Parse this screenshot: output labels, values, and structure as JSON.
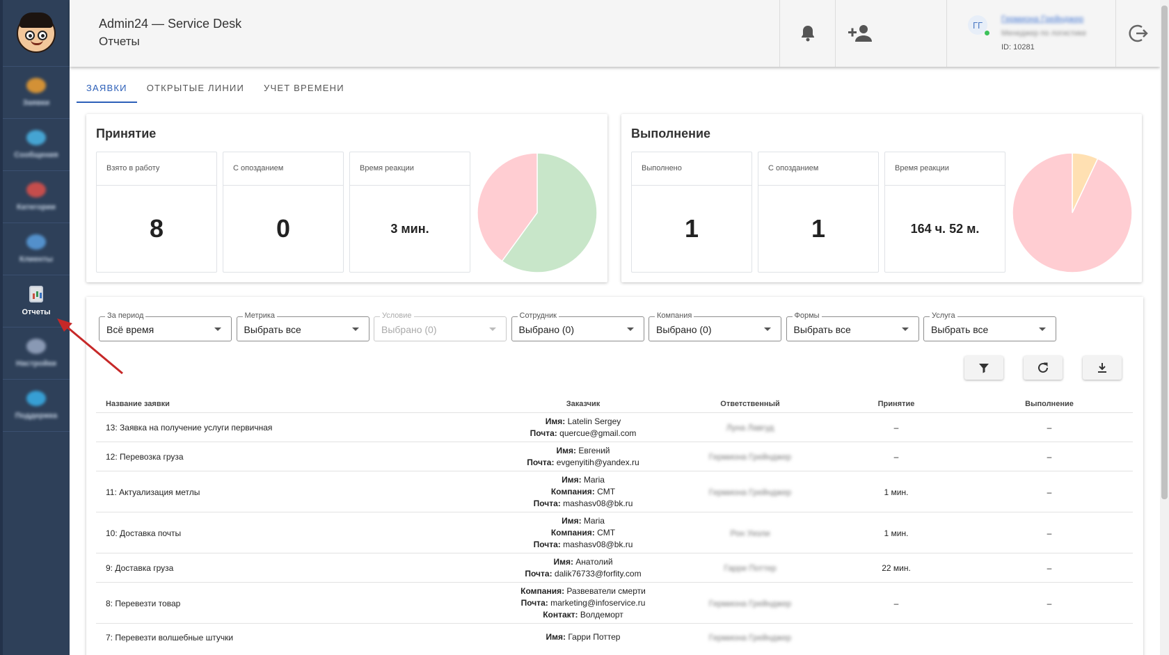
{
  "header": {
    "app_title": "Admin24 — Service Desk",
    "page_subtitle": "Отчеты",
    "user": {
      "initials": "ГГ",
      "name": "Гермиона Грейнджер",
      "role": "Менеджер по логистике",
      "id_text": "ID: 10281"
    }
  },
  "sidebar": {
    "items": [
      {
        "label": "Заявки",
        "icon": "ticket-icon",
        "color": "#f0a030"
      },
      {
        "label": "Сообщения",
        "icon": "chat-icon",
        "color": "#4ab6e8"
      },
      {
        "label": "Категории",
        "icon": "category-icon",
        "color": "#e0504a"
      },
      {
        "label": "Клиенты",
        "icon": "clients-icon",
        "color": "#5a9fe0"
      },
      {
        "label": "Отчеты",
        "icon": "reports-icon",
        "active": true
      },
      {
        "label": "Настройки",
        "icon": "settings-icon",
        "color": "#9aa9c4"
      },
      {
        "label": "Поддержка",
        "icon": "support-icon",
        "color": "#39b0ea"
      }
    ]
  },
  "tabs": [
    {
      "label": "ЗАЯВКИ",
      "active": true
    },
    {
      "label": "ОТКРЫТЫЕ ЛИНИИ"
    },
    {
      "label": "УЧЕТ ВРЕМЕНИ"
    }
  ],
  "acceptance": {
    "title": "Принятие",
    "stats": [
      {
        "label": "Взято в работу",
        "value": "8"
      },
      {
        "label": "С опозданием",
        "value": "0"
      },
      {
        "label": "Время реакции",
        "value": "3 мин."
      }
    ],
    "pie": [
      {
        "share": 0.6,
        "color": "#c8e6c9"
      },
      {
        "share": 0.4,
        "color": "#ffcdd2"
      }
    ]
  },
  "execution": {
    "title": "Выполнение",
    "stats": [
      {
        "label": "Выполнено",
        "value": "1"
      },
      {
        "label": "С опозданием",
        "value": "1"
      },
      {
        "label": "Время реакции",
        "value": "164 ч. 52 м."
      }
    ],
    "pie": [
      {
        "share": 0.07,
        "color": "#ffe0b2"
      },
      {
        "share": 0.93,
        "color": "#ffcdd2"
      }
    ]
  },
  "filters": [
    {
      "label": "За период",
      "value": "Всё время"
    },
    {
      "label": "Метрика",
      "value": "Выбрать все"
    },
    {
      "label": "Условие",
      "value": "Выбрано (0)",
      "disabled": true
    },
    {
      "label": "Сотрудник",
      "value": "Выбрано (0)"
    },
    {
      "label": "Компания",
      "value": "Выбрано (0)"
    },
    {
      "label": "Формы",
      "value": "Выбрать все"
    },
    {
      "label": "Услуга",
      "value": "Выбрать все"
    }
  ],
  "table": {
    "headers": {
      "name": "Название заявки",
      "customer": "Заказчик",
      "responsible": "Ответственный",
      "acceptance": "Принятие",
      "execution": "Выполнение"
    },
    "rows": [
      {
        "name": "13: Заявка на получение услуги первичная",
        "customer": [
          [
            "Имя:",
            "Latelin Sergey"
          ],
          [
            "Почта:",
            "quercue@gmail.com"
          ]
        ],
        "responsible": "Луна Лавгуд",
        "acceptance": "–",
        "execution": "–"
      },
      {
        "name": "12: Перевозка груза",
        "customer": [
          [
            "Имя:",
            "Евгений"
          ],
          [
            "Почта:",
            "evgenyitih@yandex.ru"
          ]
        ],
        "responsible": "Гермиона Грейнджер",
        "acceptance": "–",
        "execution": "–"
      },
      {
        "name": "11: Актуализация метлы",
        "customer": [
          [
            "Имя:",
            "Maria"
          ],
          [
            "Компания:",
            "CMT"
          ],
          [
            "Почта:",
            "mashasv08@bk.ru"
          ]
        ],
        "responsible": "Гермиона Грейнджер",
        "acceptance": "1 мин.",
        "execution": "–"
      },
      {
        "name": "10: Доставка почты",
        "customer": [
          [
            "Имя:",
            "Maria"
          ],
          [
            "Компания:",
            "CMT"
          ],
          [
            "Почта:",
            "mashasv08@bk.ru"
          ]
        ],
        "responsible": "Рон Уизли",
        "acceptance": "1 мин.",
        "execution": "–"
      },
      {
        "name": "9: Доставка груза",
        "customer": [
          [
            "Имя:",
            "Анатолий"
          ],
          [
            "Почта:",
            "dalik76733@forfity.com"
          ]
        ],
        "responsible": "Гарри Поттер",
        "acceptance": "22 мин.",
        "execution": "–"
      },
      {
        "name": "8: Перевезти товар",
        "customer": [
          [
            "Компания:",
            "Развеватели смерти"
          ],
          [
            "Почта:",
            "marketing@infoservice.ru"
          ],
          [
            "Контакт:",
            "Волдеморт"
          ]
        ],
        "responsible": "Гермиона Грейнджер",
        "acceptance": "–",
        "execution": "–"
      },
      {
        "name": "7: Перевезти волшебные штучки",
        "customer": [
          [
            "Имя:",
            "Гарри Поттер"
          ]
        ],
        "responsible": "Гермиона Грейнджер",
        "acceptance": "",
        "execution": ""
      }
    ]
  }
}
